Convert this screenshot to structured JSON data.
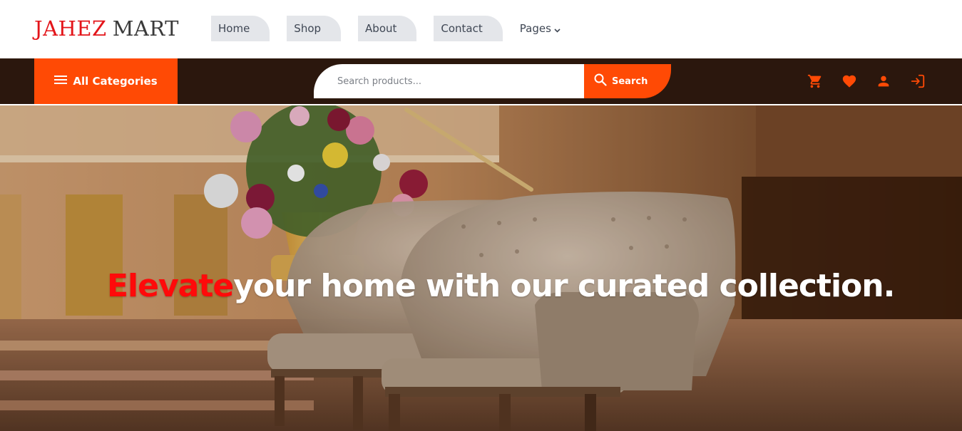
{
  "logo": {
    "part1": "JAHEZ",
    "part2": "MART"
  },
  "nav": {
    "items": [
      {
        "label": "Home"
      },
      {
        "label": "Shop"
      },
      {
        "label": "About"
      },
      {
        "label": "Contact"
      }
    ],
    "pages_label": "Pages",
    "pages_icon": "chevron-down-icon"
  },
  "toolbar": {
    "all_categories_label": "All Categories",
    "all_categories_icon": "hamburger-menu-icon",
    "search_placeholder": "Search products...",
    "search_value": "",
    "search_button_label": "Search",
    "search_icon": "search-icon",
    "action_icons": [
      "cart-icon",
      "heart-icon",
      "user-icon",
      "login-icon"
    ]
  },
  "hero": {
    "accent_word": "Elevate",
    "headline_rest": "your home with our curated collection."
  },
  "colors": {
    "accent": "#ff4a05",
    "dark_bar": "#2b170d",
    "logo_red": "#e3151a",
    "hero_accent": "#ff0a0a",
    "nav_tab_bg": "#e4e6ea"
  }
}
